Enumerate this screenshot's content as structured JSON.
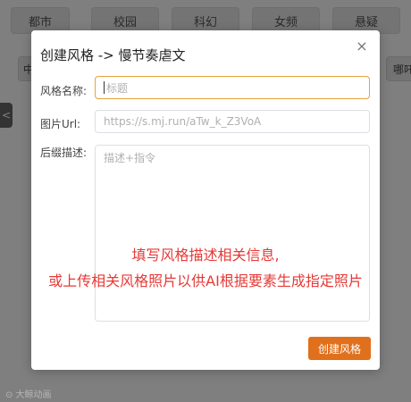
{
  "background": {
    "tabs": [
      "都市",
      "校园",
      "科幻",
      "女频",
      "悬疑"
    ],
    "side_chips": [
      "中",
      "哪吒"
    ],
    "dark_chip": "<"
  },
  "dialog": {
    "title": "创建风格 -> 慢节奏虐文",
    "close_symbol": "×",
    "fields": {
      "name_label": "风格名称:",
      "name_placeholder": "标题",
      "image_label": "图片Url:",
      "image_placeholder": "https://s.mj.run/aTw_k_Z3VoA",
      "desc_label": "后缀描述:",
      "desc_placeholder": "描述+指令"
    },
    "submit_label": "创建风格"
  },
  "annotation": {
    "line1": "填写风格描述相关信息,",
    "line2": "或上传相关风格照片以供AI根据要素生成指定照片"
  },
  "watermark": "⊙ 大鲸动画",
  "colors": {
    "accent": "#e0701c",
    "focus_border": "#e6a23c",
    "note_red": "#e53935"
  }
}
